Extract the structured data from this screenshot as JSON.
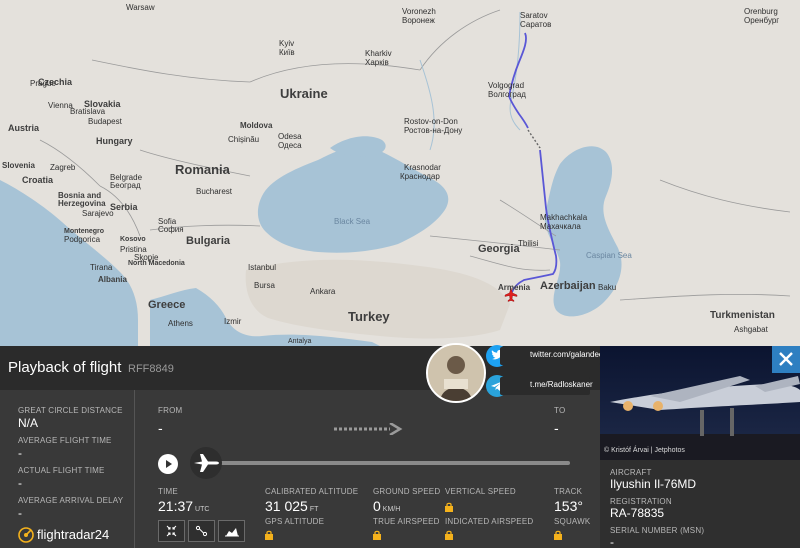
{
  "map": {
    "countries": {
      "ukraine": "Ukraine",
      "romania": "Romania",
      "bulgaria": "Bulgaria",
      "greece": "Greece",
      "turkey": "Turkey",
      "georgia": "Georgia",
      "armenia": "Armenia",
      "azerbaijan": "Azerbaijan",
      "turkmenistan": "Turkmenistan",
      "hungary": "Hungary",
      "serbia": "Serbia",
      "moldova": "Moldova",
      "czechia": "Czechia",
      "austria": "Austria",
      "slovakia": "Slovakia",
      "croatia": "Croatia",
      "bosnia": "Bosnia and Herzegovina",
      "montenegro": "Montenegro",
      "kosovo": "Kosovo",
      "albania": "Albania",
      "north_macedonia": "North Macedonia",
      "slovenia": "Slovenia"
    },
    "cities": {
      "warsaw": "Warsaw",
      "kyiv": "Kyiv",
      "kyiv_local": "Київ",
      "voronezh": "Voronezh",
      "voronezh_local": "Воронеж",
      "saratov": "Saratov",
      "saratov_local": "Саратов",
      "orenburg": "Orenburg",
      "orenburg_local": "Оренбург",
      "kharkiv": "Kharkiv",
      "kharkiv_local": "Харків",
      "volgograd": "Volgograd",
      "volgograd_local": "Волгоград",
      "rostov": "Rostov-on-Don",
      "rostov_local": "Ростов-на-Дону",
      "prague": "Prague",
      "vienna": "Vienna",
      "bratislava": "Bratislava",
      "budapest": "Budapest",
      "chisinau": "Chișinău",
      "odesa": "Odesa",
      "odesa_local": "Одеса",
      "krasnodar": "Krasnodar",
      "krasnodar_local": "Краснодар",
      "zagreb": "Zagreb",
      "belgrade": "Belgrade",
      "belgrade_local": "Београд",
      "sarajevo": "Sarajevo",
      "bucharest": "Bucharest",
      "sofia": "Sofia",
      "sofia_local": "София",
      "podgorica": "Podgorica",
      "pristina": "Pristina",
      "skopje": "Skopje",
      "tirana": "Tirana",
      "istanbul": "Istanbul",
      "bursa": "Bursa",
      "ankara": "Ankara",
      "izmir": "Izmir",
      "athens": "Athens",
      "tbilisi": "Tbilisi",
      "makhachkala": "Makhachkala",
      "makhachkala_local": "Махачкала",
      "baku": "Baku",
      "ashgabat": "Ashgabat",
      "antalya": "Antalya"
    },
    "seas": {
      "black_sea": "Black Sea",
      "caspian_sea": "Caspian Sea"
    },
    "route_color": "#5a57d6",
    "plane_marker_color": "#e02020"
  },
  "panel": {
    "title": "Playback of flight",
    "callsign": "RFF8849",
    "great_circle_label": "GREAT CIRCLE DISTANCE",
    "great_circle_value": "N/A",
    "avg_flight_time_label": "AVERAGE FLIGHT TIME",
    "avg_flight_time_value": "-",
    "actual_flight_time_label": "ACTUAL FLIGHT TIME",
    "actual_flight_time_value": "-",
    "avg_arrival_delay_label": "AVERAGE ARRIVAL DELAY",
    "avg_arrival_delay_value": "-",
    "from_label": "FROM",
    "from_value": "-",
    "to_label": "TO",
    "to_value": "-",
    "time_label": "TIME",
    "time_value": "21:37",
    "time_unit": "UTC",
    "cal_alt_label": "CALIBRATED ALTITUDE",
    "cal_alt_value": "31 025",
    "cal_alt_unit": "FT",
    "gps_alt_label": "GPS ALTITUDE",
    "ground_speed_label": "GROUND SPEED",
    "ground_speed_value": "0",
    "ground_speed_unit": "KM/H",
    "true_airspeed_label": "TRUE AIRSPEED",
    "vertical_speed_label": "VERTICAL SPEED",
    "indicated_airspeed_label": "INDICATED AIRSPEED",
    "track_label": "TRACK",
    "track_value": "153°",
    "squawk_label": "SQUAWK",
    "logo": "flightradar24"
  },
  "aircraft": {
    "photo_credit": "© Kristóf Árvai | Jetphotos",
    "aircraft_label": "AIRCRAFT",
    "aircraft_value": "Ilyushin Il-76MD",
    "registration_label": "REGISTRATION",
    "registration_value": "RA-78835",
    "serial_label": "SERIAL NUMBER (MSN)",
    "serial_value": "-"
  },
  "social": {
    "twitter": "twitter.com/galandecZP",
    "telegram": "t.me/Radloskaner",
    "twitter_color": "#1da1f2",
    "telegram_color": "#2aa3db"
  },
  "icons": [
    "twitter-icon",
    "telegram-icon",
    "play-icon",
    "airplane-icon",
    "close-icon",
    "lock-icon",
    "collapse-icon",
    "route-icon",
    "chart-icon"
  ]
}
